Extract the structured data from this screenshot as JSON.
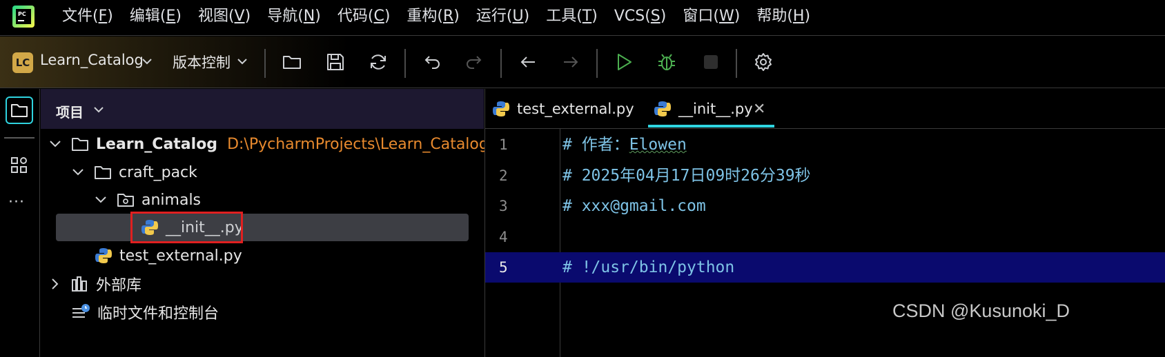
{
  "menu": {
    "items": [
      {
        "label": "文件(",
        "key": "F",
        "end": ")"
      },
      {
        "label": "编辑(",
        "key": "E",
        "end": ")"
      },
      {
        "label": "视图(",
        "key": "V",
        "end": ")"
      },
      {
        "label": "导航(",
        "key": "N",
        "end": ")"
      },
      {
        "label": "代码(",
        "key": "C",
        "end": ")"
      },
      {
        "label": "重构(",
        "key": "R",
        "end": ")"
      },
      {
        "label": "运行(",
        "key": "U",
        "end": ")"
      },
      {
        "label": "工具(",
        "key": "T",
        "end": ")"
      },
      {
        "label": "VCS(",
        "key": "S",
        "end": ")"
      },
      {
        "label": "窗口(",
        "key": "W",
        "end": ")"
      },
      {
        "label": "帮助(",
        "key": "H",
        "end": ")"
      }
    ]
  },
  "toolbar": {
    "project_badge": "LC",
    "project_name": "Learn_Catalog",
    "vcs_label": "版本控制",
    "accent": "#d2a848",
    "run_color": "#4caf50"
  },
  "project_panel": {
    "title": "项目",
    "tree": [
      {
        "label": "Learn_Catalog",
        "path": "D:\\PycharmProjects\\Learn_Catalog"
      },
      {
        "label": "craft_pack"
      },
      {
        "label": "animals"
      },
      {
        "label": "__init__.py",
        "selected": true
      },
      {
        "label": "test_external.py"
      },
      {
        "label": "外部库"
      },
      {
        "label": "临时文件和控制台"
      }
    ]
  },
  "editor": {
    "tabs": [
      {
        "label": "test_external.py",
        "active": false
      },
      {
        "label": "__init__.py",
        "active": true
      }
    ],
    "lines": [
      {
        "no": "1",
        "prefix": "# 作者：",
        "text": "Elowen"
      },
      {
        "no": "2",
        "text": "# 2025年04月17日09时26分39秒"
      },
      {
        "no": "3",
        "text": "# xxx@gmail.com"
      },
      {
        "no": "4",
        "text": ""
      },
      {
        "no": "5",
        "text": "# !/usr/bin/python"
      }
    ],
    "accent": "#2fd4e0"
  },
  "watermark": "CSDN @Kusunoki_D"
}
